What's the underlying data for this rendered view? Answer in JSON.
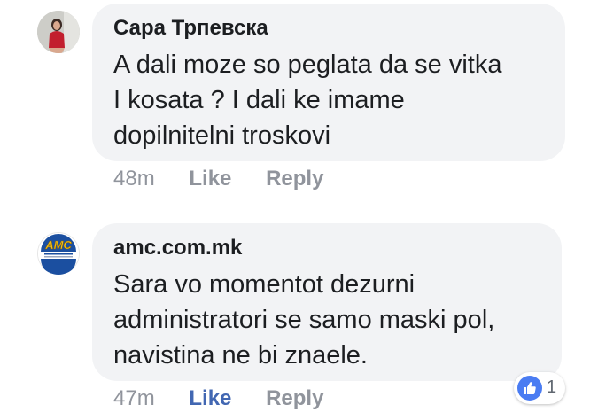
{
  "comments": [
    {
      "author": "Сара Трпевска",
      "lines": [
        "A dali moze so peglata da se vitka",
        "I kosata ? I dali ke imame",
        "dopilnitelni troskovi"
      ],
      "time": "48m",
      "like_label": "Like",
      "reply_label": "Reply",
      "liked": false
    },
    {
      "author": "amc.com.mk",
      "lines": [
        "Sara vo momentot dezurni",
        "administratori se samo maski pol,",
        "navistina ne bi znaele."
      ],
      "time": "47m",
      "like_label": "Like",
      "reply_label": "Reply",
      "liked": true,
      "reaction_count": "1"
    }
  ],
  "logo_text": "AMC",
  "colors": {
    "bubble": "#f2f3f5",
    "link_blue": "#4267b2",
    "meta_gray": "#90949c",
    "like_badge": "#4a7cf2"
  },
  "icons": {
    "reaction": "thumbs-up-icon"
  }
}
